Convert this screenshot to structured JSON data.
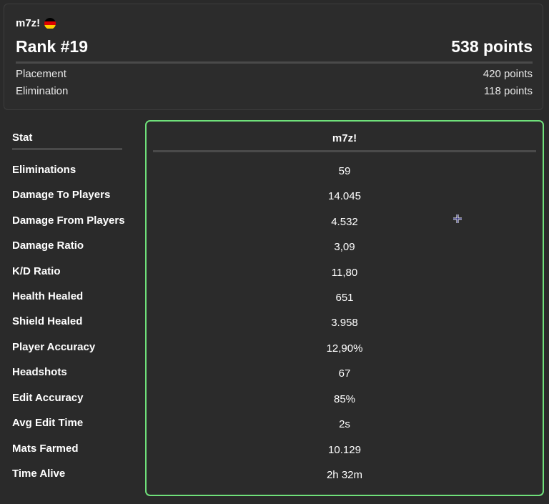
{
  "player": {
    "name": "m7z!",
    "flag_icon": "germany-flag-icon",
    "rank": "Rank #19",
    "total_points": "538 points"
  },
  "breakdown": [
    {
      "label": "Placement",
      "value": "420 points"
    },
    {
      "label": "Elimination",
      "value": "118 points"
    }
  ],
  "stats_table": {
    "stat_header": "Stat",
    "player_header": "m7z!",
    "rows": [
      {
        "label": "Eliminations",
        "value": "59"
      },
      {
        "label": "Damage To Players",
        "value": "14.045"
      },
      {
        "label": "Damage From Players",
        "value": "4.532"
      },
      {
        "label": "Damage Ratio",
        "value": "3,09"
      },
      {
        "label": "K/D Ratio",
        "value": "11,80"
      },
      {
        "label": "Health Healed",
        "value": "651"
      },
      {
        "label": "Shield Healed",
        "value": "3.958"
      },
      {
        "label": "Player Accuracy",
        "value": "12,90%"
      },
      {
        "label": "Headshots",
        "value": "67"
      },
      {
        "label": "Edit Accuracy",
        "value": "85%"
      },
      {
        "label": "Avg Edit Time",
        "value": "2s"
      },
      {
        "label": "Mats Farmed",
        "value": "10.129"
      },
      {
        "label": "Time Alive",
        "value": "2h 32m"
      }
    ]
  },
  "colors": {
    "background": "#2a2a2a",
    "panel_border": "#6fe07a",
    "divider": "#4a4a4a",
    "flag": [
      "#000000",
      "#dd0000",
      "#ffce00"
    ]
  },
  "cursor_icon": "crosshair-cursor-icon"
}
